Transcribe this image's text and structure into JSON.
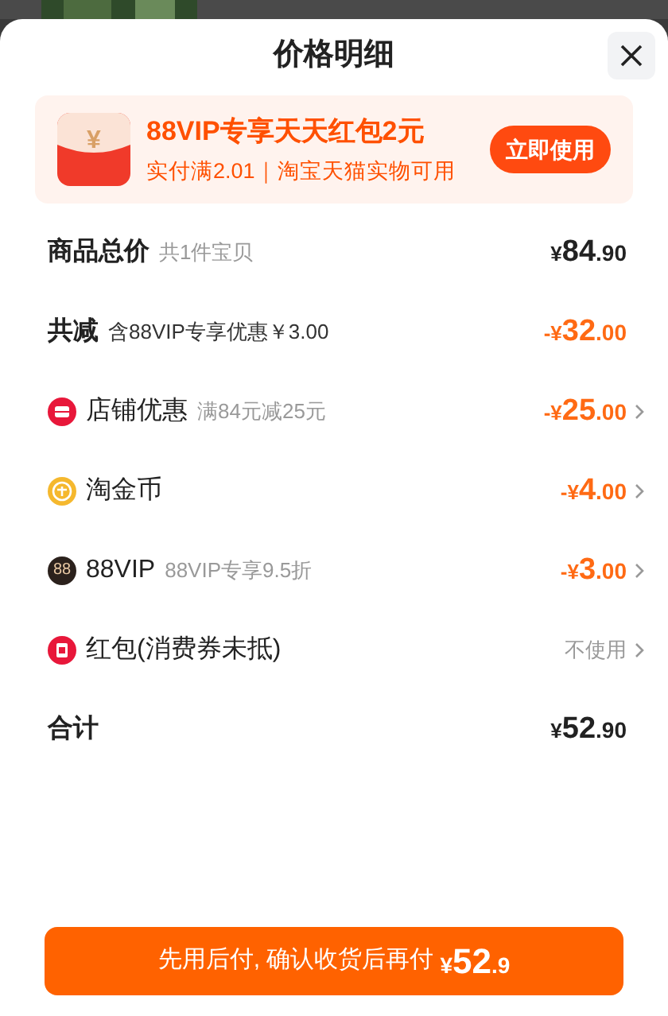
{
  "title": "价格明细",
  "banner": {
    "title": "88VIP专享天天红包2元",
    "subtitle": "实付满2.01｜淘宝天猫实物可用",
    "button": "立即使用",
    "icon_glyph": "¥"
  },
  "rows": [
    {
      "kind": "total",
      "label": "商品总价",
      "note": "共1件宝贝",
      "prefix": "¥",
      "main": "84",
      "decimals": ".90",
      "has_arrow": false
    },
    {
      "kind": "reduction",
      "label": "共减",
      "note": "含88VIP专享优惠￥3.00",
      "prefix": "-¥",
      "main": "32",
      "decimals": ".00",
      "has_arrow": false
    },
    {
      "kind": "shop",
      "label": "店铺优惠",
      "note": "满84元减25元",
      "prefix": "-¥",
      "main": "25",
      "decimals": ".00",
      "has_arrow": true
    },
    {
      "kind": "coin",
      "label": "淘金币",
      "prefix": "-¥",
      "main": "4",
      "decimals": ".00",
      "has_arrow": true
    },
    {
      "kind": "vip",
      "icon_text": "88",
      "label": "88VIP",
      "note": "88VIP专享9.5折",
      "prefix": "-¥",
      "main": "3",
      "decimals": ".00",
      "has_arrow": true
    },
    {
      "kind": "packet",
      "label": "红包(消费券未抵)",
      "value": "不使用",
      "has_arrow": true
    },
    {
      "kind": "total",
      "label": "合计",
      "prefix": "¥",
      "main": "52",
      "decimals": ".90",
      "has_arrow": false
    }
  ],
  "pay_button": {
    "text": "先用后付, 确认收货后再付",
    "prefix": "¥",
    "main": "52",
    "decimals": ".9"
  }
}
